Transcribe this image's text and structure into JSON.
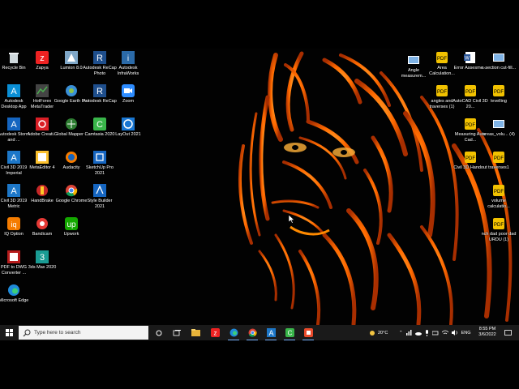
{
  "desktop": {
    "icons_left": [
      {
        "label": "Recycle Bin",
        "icon": "recycle-bin-icon"
      },
      {
        "label": "Zapya",
        "icon": "zapya-icon"
      },
      {
        "label": "Lumion 8.0",
        "icon": "lumion-icon"
      },
      {
        "label": "Autodesk ReCap Photo",
        "icon": "recap-photo-icon"
      },
      {
        "label": "Autodesk InfraWorks",
        "icon": "infraworks-icon"
      },
      {
        "label": "Autodesk Desktop App",
        "icon": "autodesk-app-icon"
      },
      {
        "label": "HotForex MetaTrader",
        "icon": "metatrader-icon"
      },
      {
        "label": "Google Earth Pro",
        "icon": "google-earth-icon"
      },
      {
        "label": "Autodesk ReCap",
        "icon": "recap-icon"
      },
      {
        "label": "Zoom",
        "icon": "zoom-icon"
      },
      {
        "label": "Autodesk Storm and ...",
        "icon": "storm-sanitary-icon"
      },
      {
        "label": "Adobe Creati...",
        "icon": "adobe-cc-icon"
      },
      {
        "label": "Global Mapper ...",
        "icon": "global-mapper-icon"
      },
      {
        "label": "Camtasia 2020",
        "icon": "camtasia-icon"
      },
      {
        "label": "LayOut 2021",
        "icon": "layout-icon"
      },
      {
        "label": "Civil 3D 2019 Imperial",
        "icon": "civil3d-imperial-icon"
      },
      {
        "label": "MetaEditor 4",
        "icon": "metaeditor-icon"
      },
      {
        "label": "Audacity",
        "icon": "audacity-icon"
      },
      {
        "label": "SketchUp Pro 2021",
        "icon": "sketchup-icon"
      },
      {
        "label": "Civil 3D 2019 Metric",
        "icon": "civil3d-metric-icon"
      },
      {
        "label": "HandBrake",
        "icon": "handbrake-icon"
      },
      {
        "label": "Google Chrome",
        "icon": "chrome-icon"
      },
      {
        "label": "Style Builder 2021",
        "icon": "style-builder-icon"
      },
      {
        "label": "IQ Option",
        "icon": "iq-option-icon"
      },
      {
        "label": "Bandicam",
        "icon": "bandicam-icon"
      },
      {
        "label": "Upwork",
        "icon": "upwork-icon"
      },
      {
        "label": "PDF to DWG Converter ...",
        "icon": "pdf-to-dwg-icon"
      },
      {
        "label": "3ds Max 2020",
        "icon": "3dsmax-icon"
      },
      {
        "label": "Microsoft Edge",
        "icon": "edge-icon"
      }
    ],
    "icons_right": [
      {
        "label": "Angle measurem...",
        "icon": "image-file-icon"
      },
      {
        "label": "Area Calculation...",
        "icon": "pdf-file-icon"
      },
      {
        "label": "Error Assesme...",
        "icon": "word-file-icon"
      },
      {
        "label": "x-section cut-fill...",
        "icon": "image-file-icon"
      },
      {
        "label": "angles and traverses (1)",
        "icon": "pdf-file-icon"
      },
      {
        "label": "AutoCAD Civil 3D 20...",
        "icon": "pdf-file-icon"
      },
      {
        "label": "levelling",
        "icon": "pdf-file-icon"
      },
      {
        "label": "Measuring Auto Cad...",
        "icon": "pdf-file-icon"
      },
      {
        "label": "areas_volu... (4)",
        "icon": "image-file-icon"
      },
      {
        "label": "Civil 3D Handout",
        "icon": "pdf-file-icon"
      },
      {
        "label": "traverses1",
        "icon": "pdf-file-icon"
      },
      {
        "label": "volume calculatio...",
        "icon": "pdf-file-icon"
      },
      {
        "label": "nch dad poor dad URDU (1)",
        "icon": "pdf-file-icon"
      }
    ]
  },
  "taskbar": {
    "search_placeholder": "Type here to search",
    "weather": "20°C",
    "language": "ENG",
    "time": "8:55 PM",
    "date": "3/6/2022",
    "pinned": [
      "file-explorer-icon",
      "zapya-icon",
      "edge-icon",
      "chrome-icon",
      "autocad-icon",
      "camtasia-icon",
      "recorder-icon"
    ]
  },
  "colors": {
    "accent": "#ff8a00",
    "taskbar": "#1a1a1a",
    "search_bg": "#f3f3f3"
  }
}
